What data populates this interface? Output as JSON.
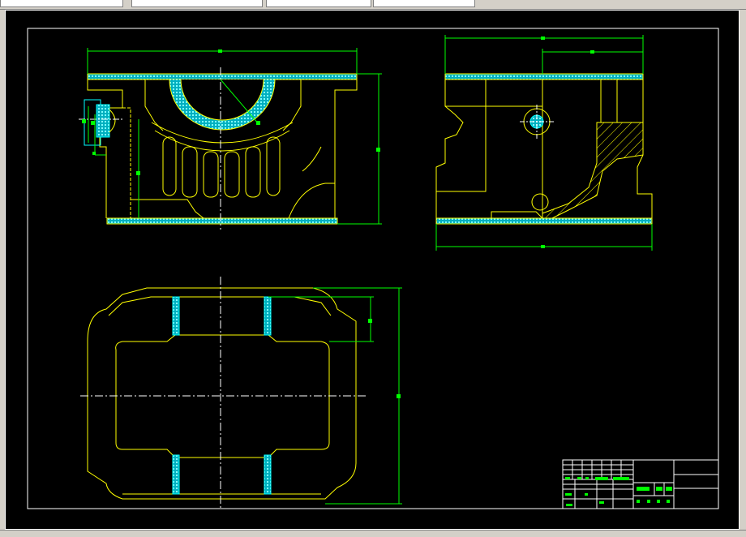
{
  "toolbar": {
    "fields": [
      "",
      "",
      "",
      ""
    ]
  },
  "drawing": {
    "background": "#000000",
    "frame_color": "#ffffff",
    "outline_color": "#ffff00",
    "dim_color": "#00ff00",
    "centerline_color": "#ffffff",
    "section_color": "#00ffff",
    "hatch_color": "#ffff00",
    "views": [
      "front-view",
      "side-view",
      "top-view"
    ]
  },
  "title_block": {
    "grid_color": "#ffffff",
    "marker_color": "#00ff00"
  }
}
